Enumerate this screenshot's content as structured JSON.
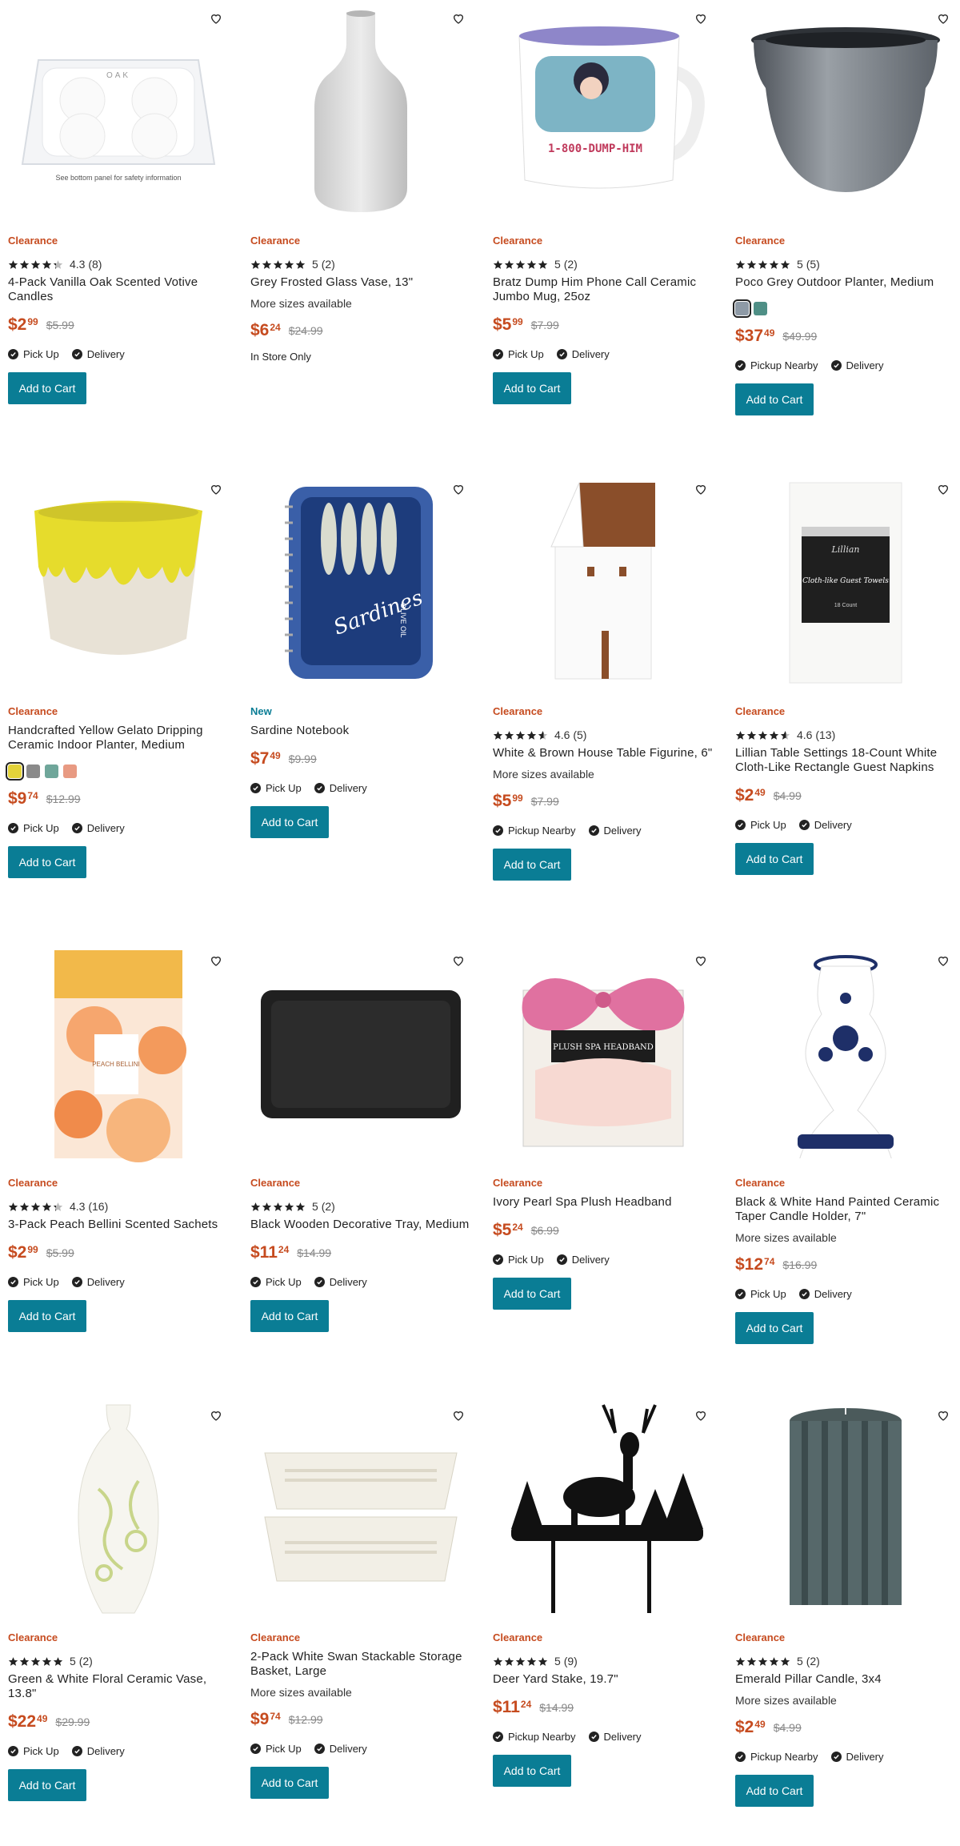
{
  "colors": {
    "accent": "#0a7d95",
    "sale": "#c64b1f"
  },
  "labels": {
    "add_to_cart": "Add to Cart"
  },
  "products": [
    {
      "badge": "Clearance",
      "rating": "4.3",
      "stars": 4.3,
      "reviews": "(8)",
      "title": "4-Pack Vanilla Oak Scented Votive Candles",
      "sale_dollars": "$2",
      "sale_cents": "99",
      "orig": "$5.99",
      "fulfillment": [
        "Pick Up",
        "Delivery"
      ],
      "icon": "votive-candle-pack-image",
      "image_text": [
        "OAK",
        "See bottom panel for safety information"
      ]
    },
    {
      "badge": "Clearance",
      "rating": "5",
      "stars": 5,
      "reviews": "(2)",
      "title": "Grey Frosted Glass Vase, 13\"",
      "more": "More sizes available",
      "sale_dollars": "$6",
      "sale_cents": "24",
      "orig": "$24.99",
      "instore": "In Store Only",
      "icon": "frosted-vase-image"
    },
    {
      "badge": "Clearance",
      "rating": "5",
      "stars": 5,
      "reviews": "(2)",
      "title": "Bratz Dump Him Phone Call Ceramic Jumbo Mug, 25oz",
      "sale_dollars": "$5",
      "sale_cents": "99",
      "orig": "$7.99",
      "fulfillment": [
        "Pick Up",
        "Delivery"
      ],
      "icon": "bratz-mug-image",
      "image_text": [
        "1-800-DUMP-HIM"
      ]
    },
    {
      "badge": "Clearance",
      "rating": "5",
      "stars": 5,
      "reviews": "(5)",
      "title": "Poco Grey Outdoor Planter, Medium",
      "swatches": [
        "#8e9aa6",
        "#4f8f86"
      ],
      "sale_dollars": "$37",
      "sale_cents": "49",
      "orig": "$49.99",
      "fulfillment": [
        "Pickup Nearby",
        "Delivery"
      ],
      "icon": "grey-planter-image"
    },
    {
      "badge": "Clearance",
      "title": "Handcrafted Yellow Gelato Dripping Ceramic Indoor Planter, Medium",
      "swatches": [
        "#e3d33a",
        "#8a8a8a",
        "#6fa69a",
        "#e89a82"
      ],
      "sale_dollars": "$9",
      "sale_cents": "74",
      "orig": "$12.99",
      "fulfillment": [
        "Pick Up",
        "Delivery"
      ],
      "icon": "yellow-drip-planter-image"
    },
    {
      "badge": "New",
      "title": "Sardine Notebook",
      "sale_dollars": "$7",
      "sale_cents": "49",
      "orig": "$9.99",
      "fulfillment": [
        "Pick Up",
        "Delivery"
      ],
      "icon": "sardine-notebook-image",
      "image_text": [
        "Sardines",
        "OLIVE OIL"
      ]
    },
    {
      "badge": "Clearance",
      "rating": "4.6",
      "stars": 4.6,
      "reviews": "(5)",
      "title": "White & Brown House Table Figurine, 6\"",
      "more": "More sizes available",
      "sale_dollars": "$5",
      "sale_cents": "99",
      "orig": "$7.99",
      "fulfillment": [
        "Pickup Nearby",
        "Delivery"
      ],
      "icon": "house-figurine-image"
    },
    {
      "badge": "Clearance",
      "rating": "4.6",
      "stars": 4.6,
      "reviews": "(13)",
      "title": "Lillian Table Settings 18-Count White Cloth-Like Rectangle Guest Napkins",
      "sale_dollars": "$2",
      "sale_cents": "49",
      "orig": "$4.99",
      "fulfillment": [
        "Pick Up",
        "Delivery"
      ],
      "icon": "guest-towels-image",
      "image_text": [
        "Lillian",
        "Cloth-like Guest Towels",
        "18 Count"
      ]
    },
    {
      "badge": "Clearance",
      "rating": "4.3",
      "stars": 4.3,
      "reviews": "(16)",
      "title": "3-Pack Peach Bellini Scented Sachets",
      "sale_dollars": "$2",
      "sale_cents": "99",
      "orig": "$5.99",
      "fulfillment": [
        "Pick Up",
        "Delivery"
      ],
      "icon": "peach-sachets-image",
      "image_text": [
        "PEACH BELLINI"
      ]
    },
    {
      "badge": "Clearance",
      "rating": "5",
      "stars": 5,
      "reviews": "(2)",
      "title": "Black Wooden Decorative Tray, Medium",
      "sale_dollars": "$11",
      "sale_cents": "24",
      "orig": "$14.99",
      "fulfillment": [
        "Pick Up",
        "Delivery"
      ],
      "icon": "black-tray-image"
    },
    {
      "badge": "Clearance",
      "title": "Ivory Pearl Spa Plush Headband",
      "sale_dollars": "$5",
      "sale_cents": "24",
      "orig": "$6.99",
      "fulfillment": [
        "Pick Up",
        "Delivery"
      ],
      "icon": "spa-headband-image",
      "image_text": [
        "PLUSH SPA HEADBAND"
      ]
    },
    {
      "badge": "Clearance",
      "title": "Black & White Hand Painted Ceramic Taper Candle Holder, 7\"",
      "more": "More sizes available",
      "sale_dollars": "$12",
      "sale_cents": "74",
      "orig": "$16.99",
      "fulfillment": [
        "Pick Up",
        "Delivery"
      ],
      "icon": "candle-holder-image"
    },
    {
      "badge": "Clearance",
      "rating": "5",
      "stars": 5,
      "reviews": "(2)",
      "title": "Green & White Floral Ceramic Vase, 13.8\"",
      "sale_dollars": "$22",
      "sale_cents": "49",
      "orig": "$29.99",
      "fulfillment": [
        "Pick Up",
        "Delivery"
      ],
      "icon": "floral-vase-image"
    },
    {
      "badge": "Clearance",
      "title": "2-Pack White Swan Stackable Storage Basket, Large",
      "more": "More sizes available",
      "sale_dollars": "$9",
      "sale_cents": "74",
      "orig": "$12.99",
      "fulfillment": [
        "Pick Up",
        "Delivery"
      ],
      "icon": "storage-basket-image"
    },
    {
      "badge": "Clearance",
      "rating": "5",
      "stars": 5,
      "reviews": "(9)",
      "title": "Deer Yard Stake, 19.7\"",
      "sale_dollars": "$11",
      "sale_cents": "24",
      "orig": "$14.99",
      "fulfillment": [
        "Pickup Nearby",
        "Delivery"
      ],
      "icon": "deer-stake-image"
    },
    {
      "badge": "Clearance",
      "rating": "5",
      "stars": 5,
      "reviews": "(2)",
      "title": "Emerald Pillar Candle, 3x4",
      "more": "More sizes available",
      "sale_dollars": "$2",
      "sale_cents": "49",
      "orig": "$4.99",
      "fulfillment": [
        "Pickup Nearby",
        "Delivery"
      ],
      "icon": "pillar-candle-image"
    }
  ]
}
